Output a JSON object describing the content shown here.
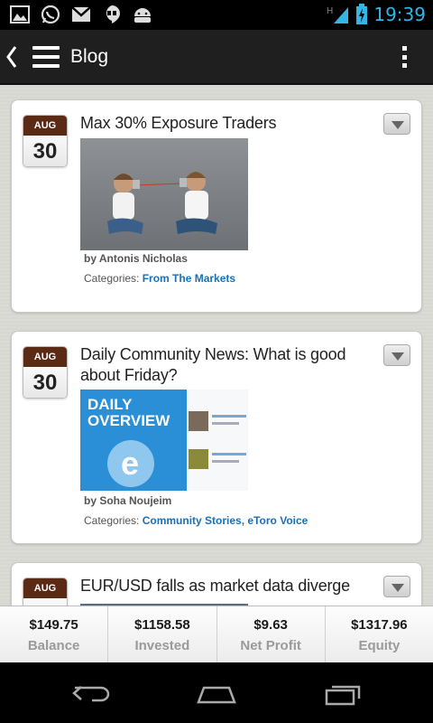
{
  "status_bar": {
    "time": "19:39",
    "icons": [
      "gallery-icon",
      "whatsapp-icon",
      "gmail-icon",
      "hangouts-icon",
      "android-icon"
    ],
    "network_label": "H"
  },
  "action_bar": {
    "title": "Blog"
  },
  "posts": [
    {
      "month": "AUG",
      "day": "30",
      "title": "Max 30% Exposure Traders",
      "author": "by Antonis Nicholas",
      "categories_label": "Categories:",
      "categories": [
        "From The Markets"
      ]
    },
    {
      "month": "AUG",
      "day": "30",
      "title": "Daily Community News: What is good about Friday?",
      "author": "by Soha Noujeim",
      "categories_label": "Categories:",
      "categories": [
        "Community Stories",
        "eToro Voice"
      ],
      "image_text": {
        "line1": "DAILY",
        "line2": "OVERVIEW"
      }
    },
    {
      "month": "AUG",
      "day": "",
      "title": "EUR/USD falls as market data diverge"
    }
  ],
  "stats": [
    {
      "value": "$149.75",
      "label": "Balance"
    },
    {
      "value": "$1158.58",
      "label": "Invested"
    },
    {
      "value": "$9.63",
      "label": "Net Profit"
    },
    {
      "value": "$1317.96",
      "label": "Equity"
    }
  ],
  "colors": {
    "date_month_bg": "#5a2a14",
    "link": "#1a6fb5",
    "clock": "#33b5e5"
  }
}
